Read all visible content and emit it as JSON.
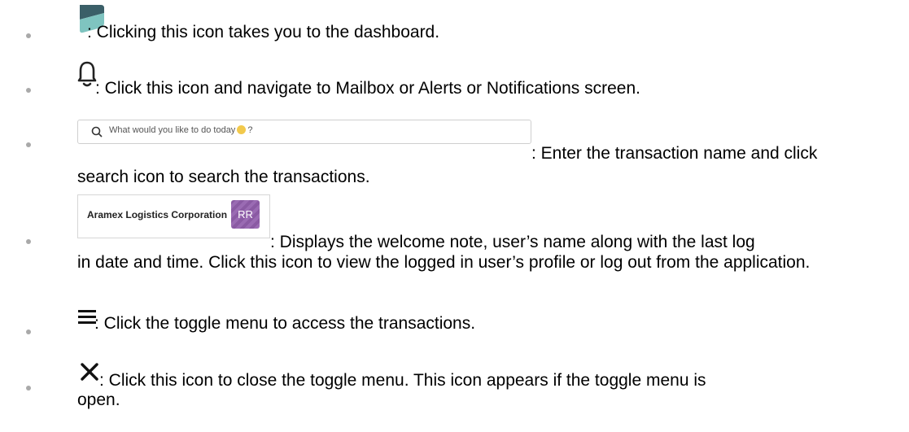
{
  "items": [
    {
      "icon": "dashboard-logo-icon",
      "text": ": Clicking this icon takes you to the dashboard."
    },
    {
      "icon": "bell-icon",
      "text": ": Click this icon and navigate to Mailbox or Alerts or Notifications screen."
    },
    {
      "icon": "search-icon",
      "search_placeholder": "What would you like to do today",
      "search_suffix": "?",
      "text_line1": ": Enter the transaction name and click",
      "text_line2": "search icon to search the transactions."
    },
    {
      "company": "Aramex Logistics Corporation",
      "avatar_initials": "RR",
      "text_line1": ": Displays the welcome note, user’s name along with the last log",
      "text_rest": "in date and time. Click this icon to view the logged in user’s profile or log out from the application."
    },
    {
      "icon": "hamburger-menu-icon",
      "text": ": Click the toggle menu to access the transactions."
    },
    {
      "icon": "close-icon",
      "text_line1": ": Click this icon to close the toggle menu. This icon appears if the toggle menu is",
      "text_line2": "open."
    }
  ],
  "colors": {
    "bullet": "#a9a9a9",
    "logo_dark": "#3b5f68",
    "logo_light": "#7fc4c0",
    "avatar": "#8a5aa3"
  }
}
